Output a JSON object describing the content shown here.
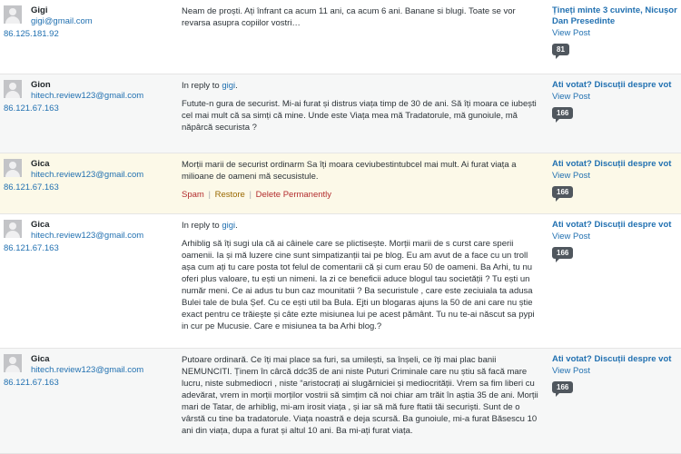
{
  "comments": [
    {
      "author": "Gigi",
      "email": "gigi@gmail.com",
      "ip": "86.125.181.92",
      "reply_prefix": "",
      "reply_to": "",
      "text": "Neam de proști. Ați înfrant ca acum 11 ani, ca acum 6 ani. Banane si blugi. Toate se vor revarsa asupra copiilor vostri…",
      "post_title": "Țineți minte 3 cuvinte, Nicușor Dan Presedinte",
      "view_post": "View Post",
      "count": "81"
    },
    {
      "author": "Gion",
      "email": "hitech.review123@gmail.com",
      "ip": "86.121.67.163",
      "reply_prefix": "In reply to",
      "reply_to": "gigi",
      "text": "Futute-n gura de securist. Mi-ai furat și distrus viața timp de 30 de ani. Să îți moara ce iubești cel mai mult că sa simți că mine. Unde este Viața mea mă Tradatorule, mă gunoiule, mă năpârcă securista ?",
      "post_title": "Ati votat? Discuții despre vot",
      "view_post": "View Post",
      "count": "166"
    },
    {
      "author": "Gica",
      "email": "hitech.review123@gmail.com",
      "ip": "86.121.67.163",
      "text": "Morții marii de securist ordinarm Sa îți moara ceviubestintubcel mai mult. Ai furat viața a milioane de oameni mă secusistule.",
      "actions": {
        "spam": "Spam",
        "restore": "Restore",
        "delete": "Delete Permanently",
        "sep": "|"
      },
      "post_title": "Ati votat? Discuții despre vot",
      "view_post": "View Post",
      "count": "166"
    },
    {
      "author": "Gica",
      "email": "hitech.review123@gmail.com",
      "ip": "86.121.67.163",
      "reply_prefix": "In reply to",
      "reply_to": "gigi",
      "text": "Arhiblig să îți sugi ula că ai câinele care se plictisește. Morții marii de s curst care sperii oamenii. Ia și mă luzere cine sunt simpatizanții tai pe blog. Eu am avut de a face cu un troll așa cum ați tu care posta tot felul de comentarii că și cum erau 50 de oameni. Ba Arhi, tu nu oferi plus valoare, tu ești un nimeni. Ia zi ce beneficii aduce blogul tau societății ? Tu ești un număr meni. Ce ai adus tu bun caz mounitatii ? Ba securistule , care este zeciuiala ta adusa Bulei tale de bula Șef. Cu ce ești util ba Bula. Ejti un blogaras ajuns la 50 de ani care nu știe exact pentru ce trăiește și câte ezte misiunea lui pe acest pământ. Tu nu te-ai născut sa pypi in cur pe Mucusie. Care e misiunea ta ba Arhi blog.?",
      "post_title": "Ati votat? Discuții despre vot",
      "view_post": "View Post",
      "count": "166"
    },
    {
      "author": "Gica",
      "email": "hitech.review123@gmail.com",
      "ip": "86.121.67.163",
      "reply_prefix": "",
      "reply_to": "",
      "text": "Putoare ordinară. Ce îți mai place sa furi, sa umilești, sa înșeli, ce îți mai plac banii NEMUNCITI. Ținem în cârcă ddc35 de ani niste Puturi Criminale care nu știu să facă mare lucru, niste submediocri , niste “aristocrați ai slugărniciei și mediocrității. Vrem sa fim liberi cu adevărat, vrem in morții morților vostrii să simțim că noi chiar am trăit în aștia 35 de ani. Morții mari de Tatar, de arhiblig, mi-am irosit viața , și iar să mă fure ftatii tăi securiști. Sunt de o vârstă cu tine ba tradatorule. Viața noastră e deja scursă. Ba gunoiule, mi-a furat Băsescu 10 ani din viața, dupa a furat și altul 10 ani. Ba mi-ați furat viața.",
      "post_title": "Ati votat? Discuții despre vot",
      "view_post": "View Post",
      "count": "166"
    }
  ]
}
